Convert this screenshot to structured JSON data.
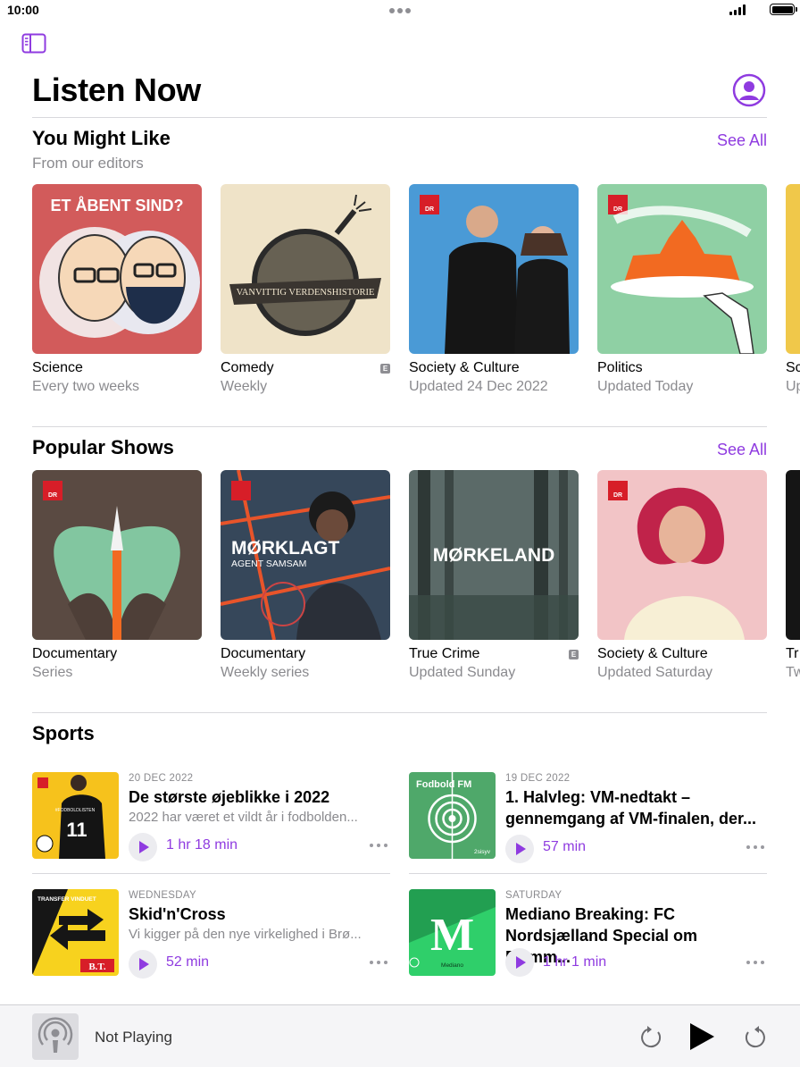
{
  "status": {
    "time": "10:00"
  },
  "header": {
    "title": "Listen Now"
  },
  "you_might_like": {
    "title": "You Might Like",
    "subtitle": "From our editors",
    "see_all": "See All",
    "cards": [
      {
        "category": "Science",
        "meta": "Every two weeks",
        "art_text": "ET ÅBENT SIND?",
        "explicit": false
      },
      {
        "category": "Comedy",
        "meta": "Weekly",
        "art_text": "VANVITTIG VERDENSHISTORIE",
        "explicit": true
      },
      {
        "category": "Society & Culture",
        "meta": "Updated 24 Dec 2022",
        "art_text": "DR",
        "explicit": false
      },
      {
        "category": "Politics",
        "meta": "Updated Today",
        "art_text": "DR",
        "explicit": false
      },
      {
        "category": "Sc",
        "meta": "Up",
        "art_text": "",
        "explicit": false
      }
    ]
  },
  "popular_shows": {
    "title": "Popular Shows",
    "see_all": "See All",
    "cards": [
      {
        "category": "Documentary",
        "meta": "Series",
        "art_text": "DR",
        "explicit": false
      },
      {
        "category": "Documentary",
        "meta": "Weekly series",
        "art_text": "MØRKLAGT",
        "art_text2": "AGENT SAMSAM",
        "explicit": false
      },
      {
        "category": "True Crime",
        "meta": "Updated Sunday",
        "art_text": "MØRKELAND",
        "explicit": true
      },
      {
        "category": "Society & Culture",
        "meta": "Updated Saturday",
        "art_text": "DR",
        "explicit": false
      },
      {
        "category": "Tr",
        "meta": "Tw",
        "art_text": "",
        "explicit": false
      }
    ]
  },
  "sports": {
    "title": "Sports",
    "episodes": [
      {
        "date": "20 DEC 2022",
        "title": "De største øjeblikke i 2022",
        "description": "2022 har været et vildt år i fodbolden...",
        "duration": "1 hr 18 min",
        "art_text": "#FODBOLDLISTEN"
      },
      {
        "date": "19 DEC 2022",
        "title": "1. Halvleg: VM-nedtakt – gennemgang af VM-finalen, der...",
        "description": "",
        "duration": "57 min",
        "art_text": "Fodbold FM",
        "art_text2": "2sisyv"
      },
      {
        "date": "WEDNESDAY",
        "title": "Skid'n'Cross",
        "description": "Vi kigger på den nye virkelighed i Brø...",
        "duration": "52 min",
        "art_text": "TRANSFER VINDUET",
        "art_text2": "B.T."
      },
      {
        "date": "SATURDAY",
        "title": "Mediano Breaking: FC Nordsjælland Special om Flemm...",
        "description": "",
        "duration": "1 hr 1 min",
        "art_text": "M",
        "art_text2": "Mediano"
      }
    ]
  },
  "mini_player": {
    "label": "Not Playing"
  },
  "colors": {
    "accent": "#8f3be0",
    "secondary_text": "#8a8a8e"
  }
}
